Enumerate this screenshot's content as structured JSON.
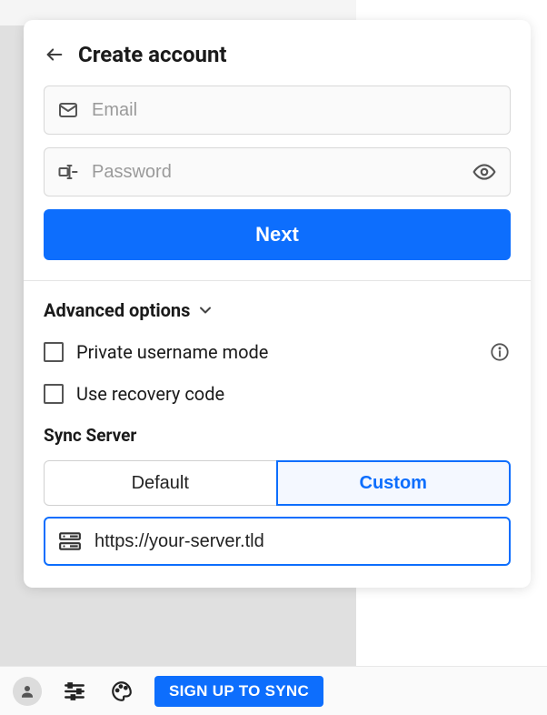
{
  "header": {
    "title": "Create account"
  },
  "fields": {
    "email": {
      "placeholder": "Email",
      "value": ""
    },
    "password": {
      "placeholder": "Password",
      "value": ""
    }
  },
  "buttons": {
    "next": "Next"
  },
  "advanced": {
    "title": "Advanced options",
    "privateUsername": {
      "label": "Private username mode",
      "checked": false
    },
    "recoveryCode": {
      "label": "Use recovery code",
      "checked": false
    },
    "syncServer": {
      "title": "Sync Server",
      "segments": {
        "default": "Default",
        "custom": "Custom"
      },
      "selected": "custom",
      "url": "https://your-server.tld"
    }
  },
  "bottomBar": {
    "signUp": "SIGN UP TO SYNC"
  },
  "icons": {
    "back": "arrow-left",
    "email": "mail",
    "password": "form-textbox-password",
    "eye": "eye",
    "chevron": "chevron-down",
    "info": "info-outline",
    "server": "server",
    "avatar": "user",
    "tune": "tune",
    "palette": "palette"
  },
  "colors": {
    "accent": "#0d6efd"
  }
}
